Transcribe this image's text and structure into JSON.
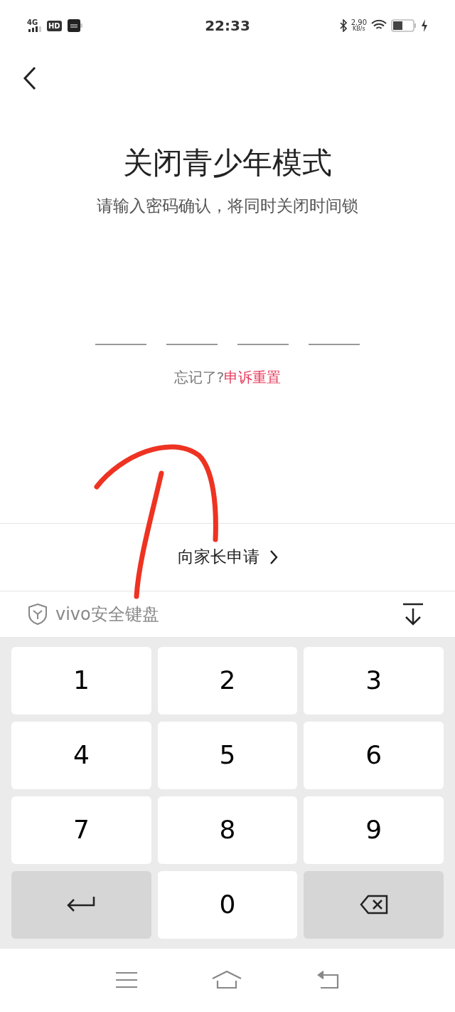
{
  "status_bar": {
    "network": "4G",
    "hd": "HD",
    "time": "22:33",
    "speed_value": "2.90",
    "speed_unit": "KB/s"
  },
  "title": "关闭青少年模式",
  "subtitle": "请输入密码确认，将同时关闭时间锁",
  "pin_slots": [
    {
      "filled": false
    },
    {
      "filled": false
    },
    {
      "filled": false
    },
    {
      "filled": false
    }
  ],
  "forgot": {
    "text": "忘记了?",
    "link": "申诉重置"
  },
  "parent_request": "向家长申请",
  "keyboard": {
    "title": "vivo安全键盘",
    "keys": [
      {
        "kind": "digit",
        "label": "1"
      },
      {
        "kind": "digit",
        "label": "2"
      },
      {
        "kind": "digit",
        "label": "3"
      },
      {
        "kind": "digit",
        "label": "4"
      },
      {
        "kind": "digit",
        "label": "5"
      },
      {
        "kind": "digit",
        "label": "6"
      },
      {
        "kind": "digit",
        "label": "7"
      },
      {
        "kind": "digit",
        "label": "8"
      },
      {
        "kind": "digit",
        "label": "9"
      },
      {
        "kind": "enter"
      },
      {
        "kind": "digit",
        "label": "0"
      },
      {
        "kind": "delete"
      }
    ]
  }
}
